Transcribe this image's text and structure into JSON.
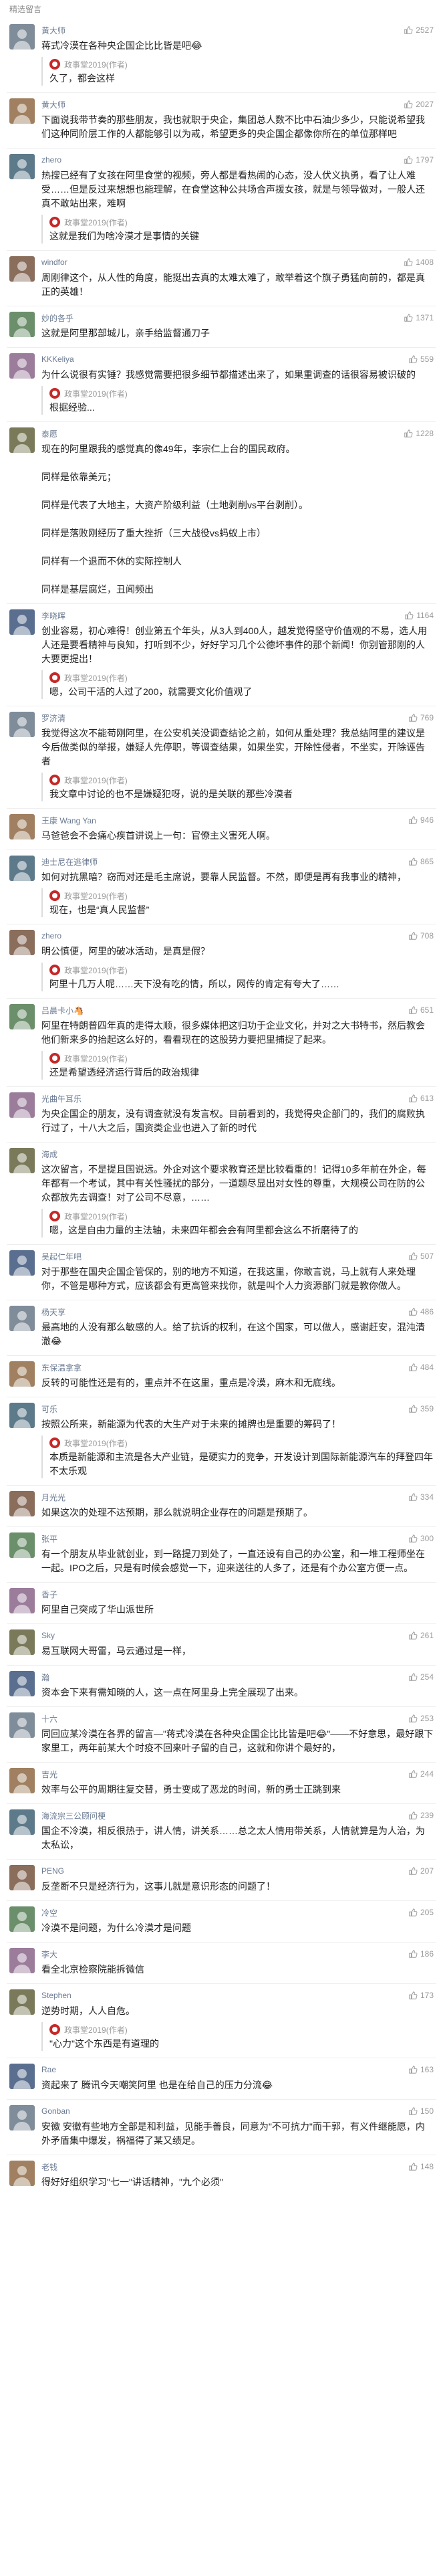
{
  "header": {
    "title": "精选留言"
  },
  "reply_author": "政事堂2019(作者)",
  "comments": [
    {
      "name": "黄大师",
      "likes": "2527",
      "text": "蒋式冷漠在各种央企国企比比皆是吧😂",
      "reply": "久了，都会这样"
    },
    {
      "name": "黄大师",
      "likes": "2027",
      "text": "下面说我带节奏的那些朋友，我也就职于央企，集团总人数不比中石油少多少，只能说希望我们这种同阶层工作的人都能够引以为戒，希望更多的央企国企都像你所在的单位那样吧",
      "reply": ""
    },
    {
      "name": "zhero",
      "likes": "1797",
      "text": "热搜已经有了女孩在阿里食堂的视频，旁人都是看热闹的心态，没人伏义执勇，看了让人难受……但是反过来想想也能理解，在食堂这种公共场合声援女孩，就是与领导做对，一般人还真不敢站出来，难啊",
      "reply": "这就是我们为啥冷漠才是事情的关键"
    },
    {
      "name": "windfor",
      "likes": "1408",
      "text": "周刚律这个，从人性的角度，能挺出去真的太难太难了，敢举着这个旗子勇猛向前的，都是真正的英雄！",
      "reply": ""
    },
    {
      "name": "妙的各乎",
      "likes": "1371",
      "text": "这就是阿里那部城儿，亲手给监督通刀子",
      "reply": ""
    },
    {
      "name": "KKKeliya",
      "likes": "559",
      "text": "为什么说很有实锤？我感觉需要把很多细节都描述出来了，如果重调查的话很容易被识破的",
      "reply": "根据经验..."
    },
    {
      "name": "泰愿",
      "likes": "1228",
      "text": "现在的阿里跟我的感觉真的像49年，李宗仁上台的国民政府。\n\n同样是依靠美元；\n\n同样是代表了大地主，大资产阶级利益（土地剥削vs平台剥削）。\n\n同样是落败刚经历了重大挫折（三大战役vs蚂蚁上市）\n\n同样有一个退而不休的实际控制人\n\n同样是基层腐烂，丑闻频出",
      "reply": ""
    },
    {
      "name": "李晓晖",
      "likes": "1164",
      "text": "创业容易，初心难得！创业第五个年头，从3人到400人，越发觉得坚守价值观的不易，选人用人还是要看精神与良知，打听到不少，好好学习几个公德坏事件的那个新闻！你别管那刚的人大要更提出！",
      "reply": "嗯，公司干活的人过了200，就需要文化价值观了"
    },
    {
      "name": "罗济清",
      "likes": "769",
      "text": "我觉得这次不能苟刚阿里，在公安机关没调查结论之前，如何从重处理？我总结阿里的建议是今后做类似的举报，嫌疑人先停职，等调查结果，如果坐实，开除性侵者，不坐实，开除诬告者",
      "reply": "我文章中讨论的也不是嫌疑犯呀，说的是关联的那些冷漠者"
    },
    {
      "name": "王康 Wang Yan",
      "likes": "946",
      "text": "马爸爸会不会痛心疾首讲说上一句：官僚主义害死人啊。",
      "reply": ""
    },
    {
      "name": "迪士尼在逃律师",
      "likes": "865",
      "text": "如何对抗黑暗？窃而对还是毛主席说，要靠人民监督。不然，即便是再有我事业的精神，",
      "reply": "现在，也是“真人民监督”"
    },
    {
      "name": "zhero",
      "likes": "708",
      "text": "明公慎便，阿里的破冰活动，是真是假？",
      "reply": "阿里十几万人呢……天下没有吃的情，所以，网传的肯定有夸大了……"
    },
    {
      "name": "吕晨卡小🐴",
      "likes": "651",
      "text": "阿里在特朗普四年真的走得太顺，很多媒体把这归功于企业文化，并对之大书特书，然后教会他们新来多的抬起这么好的，看看现在的这股势力要把里捕捉了起来。",
      "reply": "还是希望透经济运行背后的政治规律"
    },
    {
      "name": "光曲午耳乐",
      "likes": "613",
      "text": "为央企国企的朋友，没有调查就没有发言权。目前看到的，我觉得央企部门的，我们的腐败执行过了，十八大之后，国资类企业也进入了新的时代",
      "reply": ""
    },
    {
      "name": "海成",
      "likes": "",
      "text": "这次留言，不是提且国说远。外企对这个要求教育还是比较看重的！记得10多年前在外企，每年都有一个考试，其中有关性骚扰的部分，一道题尽显出对女性的尊重，大规模公司在防的公众都放先去调查！对了公司不尽意，……",
      "reply": "嗯，这是自由力量的主法轴，未来四年都会会有阿里都会这么不折磨待了的"
    },
    {
      "name": "吴起仁年吧",
      "likes": "507",
      "text": "对于那些在国央企国企管保的，别的地方不知道，在我这里，你敢言说，马上就有人来处理你，不管是哪种方式，应该都会有更高管来找你，就是叫个人力资源部门就是教你做人。\n",
      "reply": ""
    },
    {
      "name": "杨天享",
      "likes": "486",
      "text": "最高地的人没有那么敏感的人。给了抗诉的权利，在这个国家，可以做人，感谢赶安，混沌清澈😂",
      "reply": ""
    },
    {
      "name": "东保温拿拿",
      "likes": "484",
      "text": "反转的可能性还是有的，重点并不在这里，重点是冷漠，麻木和无底线。",
      "reply": ""
    },
    {
      "name": "可乐",
      "likes": "359",
      "text": "按照公所来，新能源为代表的大生产对于未来的摊牌也是重要的筹码了！",
      "reply": "本质是新能源和主流是各大产业链，是硬实力的竞争，开发设计到国际新能源汽车的拜登四年不太乐观"
    },
    {
      "name": "月光光",
      "likes": "334",
      "text": "如果这次的处理不达预期，那么就说明企业存在的问题是预期了。",
      "reply": ""
    },
    {
      "name": "张平",
      "likes": "300",
      "text": "有一个朋友从毕业就创业，到一路提刀到处了，一直还设有自己的办公室，和一堆工程师坐在一起。IPO之后，只是有时候会感觉一下，迎来送往的人多了，还是有个办公室方便一点。",
      "reply": ""
    },
    {
      "name": "香子",
      "likes": "",
      "text": "阿里自己突成了华山派世所",
      "reply": ""
    },
    {
      "name": "Sky",
      "likes": "261",
      "text": "易互联网大哥雷，马云通过是一样，",
      "reply": ""
    },
    {
      "name": "瀚",
      "likes": "254",
      "text": "资本会下来有需知晓的人，这一点在阿里身上完全展现了出来。",
      "reply": ""
    },
    {
      "name": "十六",
      "likes": "253",
      "text": "同回应某冷漠在各界的留言—\"蒋式冷漠在各种央企国企比比皆是吧😂\"——不好意思，最好跟下家里工，两年前某大个时疫不回来叶子留的自己，这就和你讲个最好的，",
      "reply": ""
    },
    {
      "name": "吉光",
      "likes": "244",
      "text": "效率与公平的周期往复交替，勇士变成了恶龙的时间，新的勇士正跳到来",
      "reply": ""
    },
    {
      "name": "海流宗三公顾问梗",
      "likes": "239",
      "text": "国企不冷漠，相反很热于，讲人情，讲关系……总之太人情用带关系，人情就算是为人治，为太私讼，",
      "reply": ""
    },
    {
      "name": "PENG",
      "likes": "207",
      "text": "反垄断不只是经济行为，这事儿就是意识形态的问题了！",
      "reply": ""
    },
    {
      "name": "冷空",
      "likes": "205",
      "text": "冷漠不是问题，为什么冷漠才是问题",
      "reply": ""
    },
    {
      "name": "李大",
      "likes": "186",
      "text": "看全北京检察院能拆微信",
      "reply": ""
    },
    {
      "name": "Stephen",
      "likes": "173",
      "text": "逆势时期，人人自危。",
      "reply": "\"心力\"这个东西是有道理的"
    },
    {
      "name": "Rae",
      "likes": "163",
      "text": "资起来了 腾讯今天嘲笑阿里 也是在给自己的压力分流😂",
      "reply": ""
    },
    {
      "name": "Gonban",
      "likes": "150",
      "text": "安徽 安徽有些地方全部是和利益，见能手善良，同意为\"不可抗力\"而干郭，有义件继能愿，内外矛盾集中爆发，祸福得了某又绩足。",
      "reply": ""
    },
    {
      "name": "老钱",
      "likes": "148",
      "text": "得好好组织学习\"七一\"讲话精神，\"九个必须\"",
      "reply": ""
    }
  ]
}
